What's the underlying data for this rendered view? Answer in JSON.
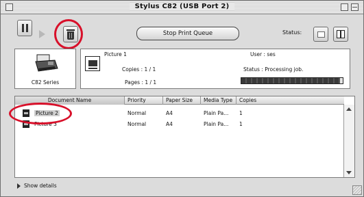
{
  "window": {
    "title": "Stylus C82 (USB Port 2)"
  },
  "toolbar": {
    "pause_icon": "pause-icon",
    "resume_icon": "play-icon",
    "delete_icon": "trash-icon",
    "stop_queue_label": "Stop Print Queue",
    "status_label": "Status:",
    "ink_icon": "ink-level-icon",
    "columns_icon": "columns-icon"
  },
  "printer": {
    "name": "C82 Series",
    "icon": "printer-icon"
  },
  "current_job": {
    "name": "Picture 1",
    "copies": "Copies : 1 / 1",
    "pages": "Pages : 1 / 1",
    "user": "User : ses",
    "status": "Status : Processing job.",
    "progress": 0.97
  },
  "queue": {
    "columns": [
      "Document Name",
      "Priority",
      "Paper Size",
      "Media Type",
      "Copies"
    ],
    "rows": [
      {
        "name": "Picture 2",
        "priority": "Normal",
        "paper_size": "A4",
        "media_type": "Plain Pa...",
        "copies": "1",
        "selected": true
      },
      {
        "name": "Picture 3",
        "priority": "Normal",
        "paper_size": "A4",
        "media_type": "Plain Pa...",
        "copies": "1",
        "selected": false
      }
    ]
  },
  "footer": {
    "show_details_label": "Show details"
  },
  "colors": {
    "highlight_circle": "#d8102a",
    "window_bg": "#dcdcdc"
  }
}
